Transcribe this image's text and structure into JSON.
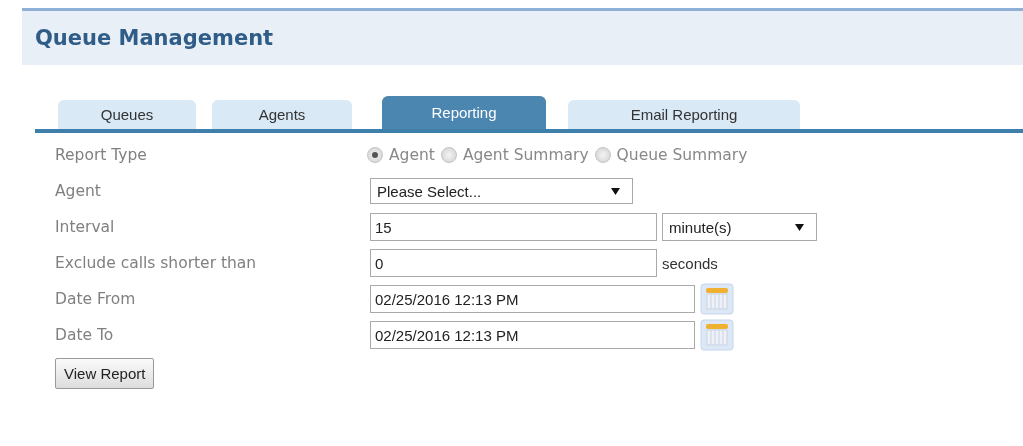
{
  "title": "Queue Management",
  "tabs": [
    {
      "label": "Queues",
      "selected": false
    },
    {
      "label": "Agents",
      "selected": false
    },
    {
      "label": "Reporting",
      "selected": true
    },
    {
      "label": "Email Reporting",
      "selected": false
    }
  ],
  "form": {
    "rows": [
      {
        "kind": "radio",
        "label": "Report Type",
        "options": [
          {
            "label": "Agent",
            "selected": true
          },
          {
            "label": "Agent Summary",
            "selected": false
          },
          {
            "label": "Queue Summary",
            "selected": false
          }
        ]
      },
      {
        "kind": "select",
        "label": "Agent",
        "value": "Please Select..."
      },
      {
        "kind": "input_select",
        "label": "Interval",
        "value": "15",
        "unit": "minute(s)"
      },
      {
        "kind": "input_suffix",
        "label": "Exclude calls shorter than",
        "value": "0",
        "suffix": "seconds"
      },
      {
        "kind": "date",
        "label": "Date From",
        "value": "02/25/2016 12:13 PM"
      },
      {
        "kind": "date",
        "label": "Date To",
        "value": "02/25/2016 12:13 PM"
      }
    ]
  },
  "button": "View Report"
}
